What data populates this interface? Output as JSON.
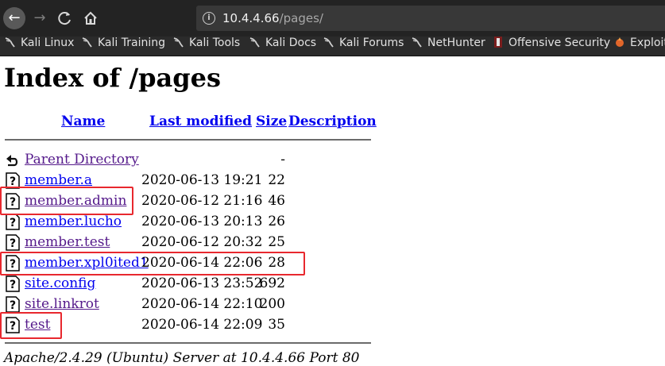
{
  "browser": {
    "url_host": "10.4.4.66",
    "url_path": "/pages/",
    "bookmarks": [
      {
        "label": "Kali Linux",
        "icon": "kali-dragon-icon"
      },
      {
        "label": "Kali Training",
        "icon": "kali-dragon-icon"
      },
      {
        "label": "Kali Tools",
        "icon": "kali-dragon-icon"
      },
      {
        "label": "Kali Docs",
        "icon": "kali-dragon-icon"
      },
      {
        "label": "Kali Forums",
        "icon": "kali-dragon-icon"
      },
      {
        "label": "NetHunter",
        "icon": "kali-dragon-icon"
      },
      {
        "label": "Offensive Security",
        "icon": "offsec-icon"
      },
      {
        "label": "Exploit",
        "icon": "exploit-db-icon"
      }
    ]
  },
  "page": {
    "title": "Index of /pages",
    "columns": {
      "name": "Name",
      "last_modified": "Last modified",
      "size": "Size",
      "description": "Description"
    },
    "parent": {
      "name": "Parent Directory",
      "size": "-"
    },
    "files": [
      {
        "name": "member.a",
        "modified": "2020-06-13 19:21",
        "size": "22",
        "visited": false
      },
      {
        "name": "member.admin",
        "modified": "2020-06-12 21:16",
        "size": "46",
        "visited": true
      },
      {
        "name": "member.lucho",
        "modified": "2020-06-13 20:13",
        "size": "26",
        "visited": false
      },
      {
        "name": "member.test",
        "modified": "2020-06-12 20:32",
        "size": "25",
        "visited": true
      },
      {
        "name": "member.xpl0ited1",
        "modified": "2020-06-14 22:06",
        "size": "28",
        "visited": false
      },
      {
        "name": "site.config",
        "modified": "2020-06-13 23:52",
        "size": "692",
        "visited": false
      },
      {
        "name": "site.linkrot",
        "modified": "2020-06-14 22:10",
        "size": "200",
        "visited": true
      },
      {
        "name": "test",
        "modified": "2020-06-14 22:09",
        "size": "35",
        "visited": true
      }
    ],
    "footer": "Apache/2.4.29 (Ubuntu) Server at 10.4.4.66 Port 80",
    "highlight_color": "#e8282e"
  }
}
